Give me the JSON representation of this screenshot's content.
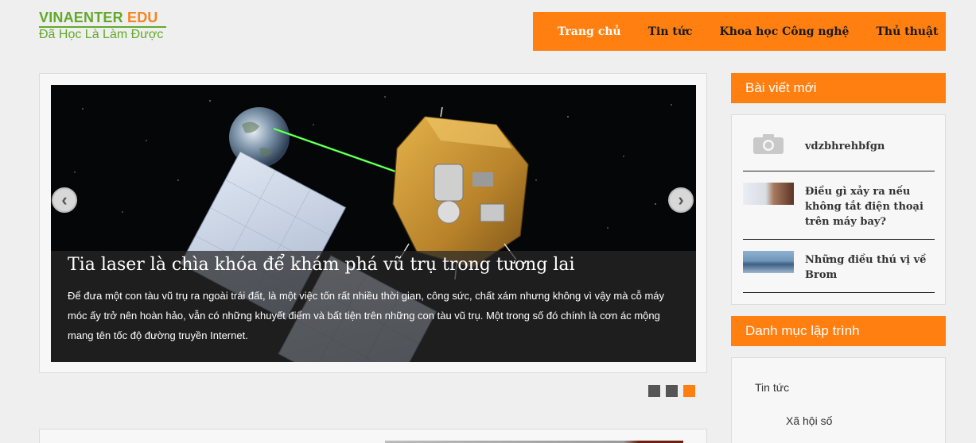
{
  "logo": {
    "name_part1": "VINAENTER ",
    "name_part2": "EDU",
    "tagline": "Đã Học Là Làm Được"
  },
  "nav": {
    "items": [
      "Trang chủ",
      "Tin tức",
      "Khoa học Công nghệ",
      "Thủ thuật"
    ],
    "active": "Trang chủ"
  },
  "slider": {
    "title": "Tia laser là chìa khóa để khám phá vũ trụ trong tương lai",
    "text": "Để đưa một con tàu vũ trụ ra ngoài trái đất, là một việc tốn rất nhiều thời gian, công sức, chất xám nhưng không vì vậy mà cỗ máy móc ấy trở nên hoàn hảo, vẫn có những khuyết điểm và bất tiện trên những con tàu vũ trụ. Một trong số đó chính là cơn ác mộng mang tên tốc độ đường truyền Internet.",
    "prev_icon": "chevron-left-icon",
    "next_icon": "chevron-right-icon",
    "pager_count": 3,
    "pager_active": 3
  },
  "sidebar": {
    "recent_heading": "Bài viết mới",
    "recent_posts": [
      {
        "title": "vdzbhrehbfgn",
        "thumb": "camera-placeholder-icon"
      },
      {
        "title": "Điều gì xảy ra nếu không tắt điện thoại trên máy bay?",
        "thumb": "photo"
      },
      {
        "title": "Những điều thú vị về Brom",
        "thumb": "photo"
      }
    ],
    "category_heading": "Danh mục lập trình",
    "categories": [
      "Tin tức",
      "Xã hội số"
    ]
  },
  "colors": {
    "accent": "#ff7f11",
    "logo_green": "#62a92b",
    "background": "#efefef"
  }
}
